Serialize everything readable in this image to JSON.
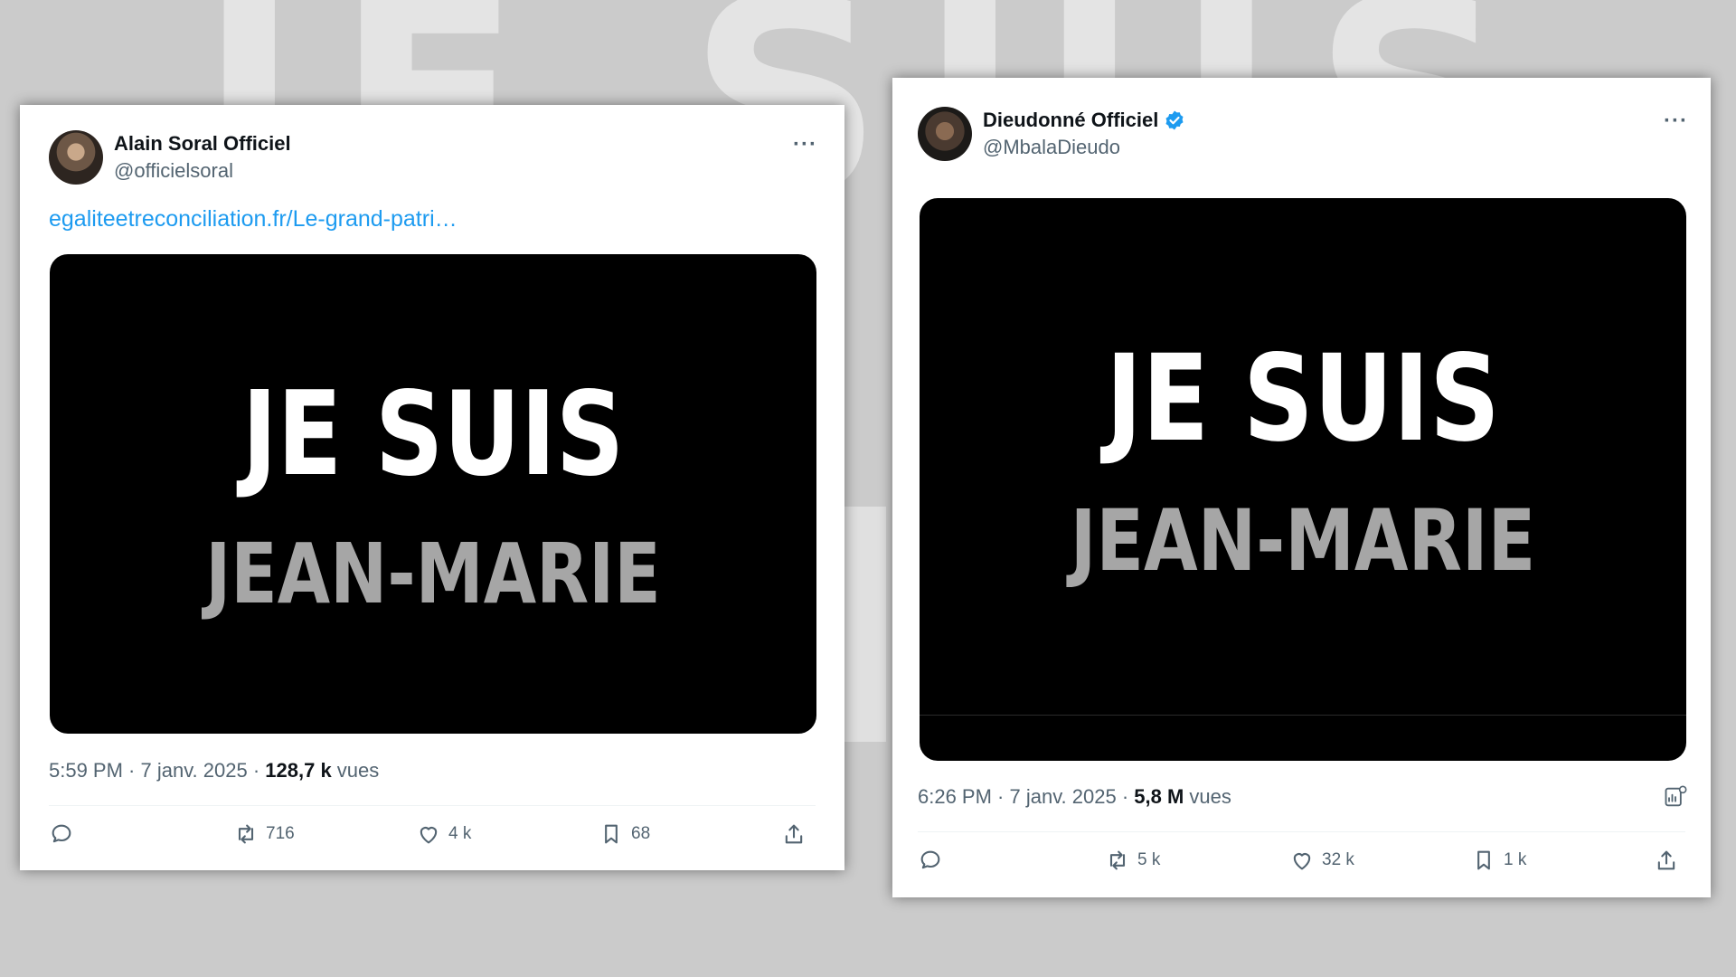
{
  "tweets": [
    {
      "author_name": "Alain Soral Officiel",
      "handle": "@officielsoral",
      "verified": false,
      "link_text": "egaliteetreconciliation.fr/Le-grand-patri…",
      "media_line1": "JE SUIS",
      "media_line2": "JEAN-MARIE",
      "time": "5:59 PM · 7 janv. 2025 · ",
      "views_count": "128,7 k",
      "views_label": " vues",
      "stats": {
        "replies": "",
        "retweets": "716",
        "likes": "4 k",
        "bookmarks": "68"
      }
    },
    {
      "author_name": "Dieudonné Officiel",
      "handle": "@MbalaDieudo",
      "verified": true,
      "media_line1": "JE SUIS",
      "media_line2": "JEAN-MARIE",
      "time": "6:26 PM · 7 janv. 2025 · ",
      "views_count": "5,8 M",
      "views_label": " vues",
      "stats": {
        "replies": "",
        "retweets": "5 k",
        "likes": "32 k",
        "bookmarks": "1 k"
      }
    }
  ],
  "icons": {
    "more": "more-horizontal-icon",
    "verified": "verified-badge-icon",
    "reply": "reply-icon",
    "retweet": "retweet-icon",
    "like": "heart-icon",
    "bookmark": "bookmark-icon",
    "share": "share-icon",
    "analytics": "analytics-icon"
  },
  "colors": {
    "link": "#1d9bf0",
    "verified": "#1d9bf0",
    "text": "#0f1419",
    "muted": "#536471"
  }
}
